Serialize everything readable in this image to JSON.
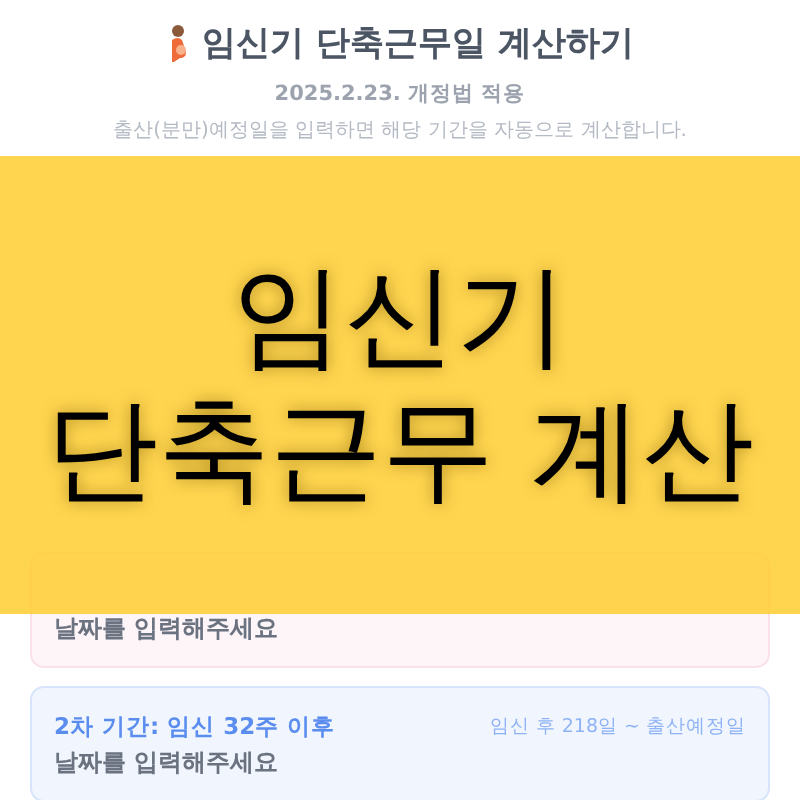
{
  "header": {
    "title": "임신기 단축근무일 계산하기",
    "subtitle": "2025.2.23. 개정법 적용",
    "description": "출산(분만)예정일을 입력하면 해당 기간을 자동으로 계산합니다."
  },
  "results": {
    "periods": [
      {
        "kind": "first",
        "message": "날짜를 입력해주세요"
      },
      {
        "kind": "second",
        "title": "2차 기간: 임신 32주 이후",
        "range": "임신 후 218일 ~ 출산예정일",
        "message": "날짜를 입력해주세요"
      }
    ]
  },
  "banner": {
    "lines": [
      "임신기",
      "단축근무 계산"
    ]
  }
}
